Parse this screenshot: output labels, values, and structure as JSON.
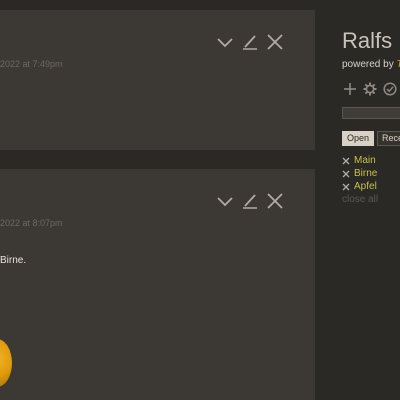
{
  "story": {
    "tiddlers": [
      {
        "subtitle": "2022 at 7:49pm",
        "body": ""
      },
      {
        "subtitle": "2022 at 8:07pm",
        "body": "Birne."
      }
    ]
  },
  "sidebar": {
    "site_title": "Ralfs N",
    "powered_by_prefix": "powered by ",
    "powered_by_link": "Ti",
    "search_placeholder": "",
    "tabs": [
      {
        "label": "Open",
        "active": true
      },
      {
        "label": "Recent",
        "active": false
      }
    ],
    "open_items": [
      {
        "label": "Main"
      },
      {
        "label": "Birne"
      },
      {
        "label": "Apfel"
      }
    ],
    "close_all_label": "close all"
  },
  "icons": {
    "tiddler_controls": [
      "chevron-down-icon",
      "edit-icon",
      "close-icon"
    ],
    "page_controls": [
      "plus-icon",
      "gear-icon",
      "check-circle-icon"
    ]
  },
  "colors": {
    "background": "#2b2926",
    "tiddler_bg": "#3c3833",
    "link": "#c7c046",
    "powered_link": "#d4a72c"
  }
}
